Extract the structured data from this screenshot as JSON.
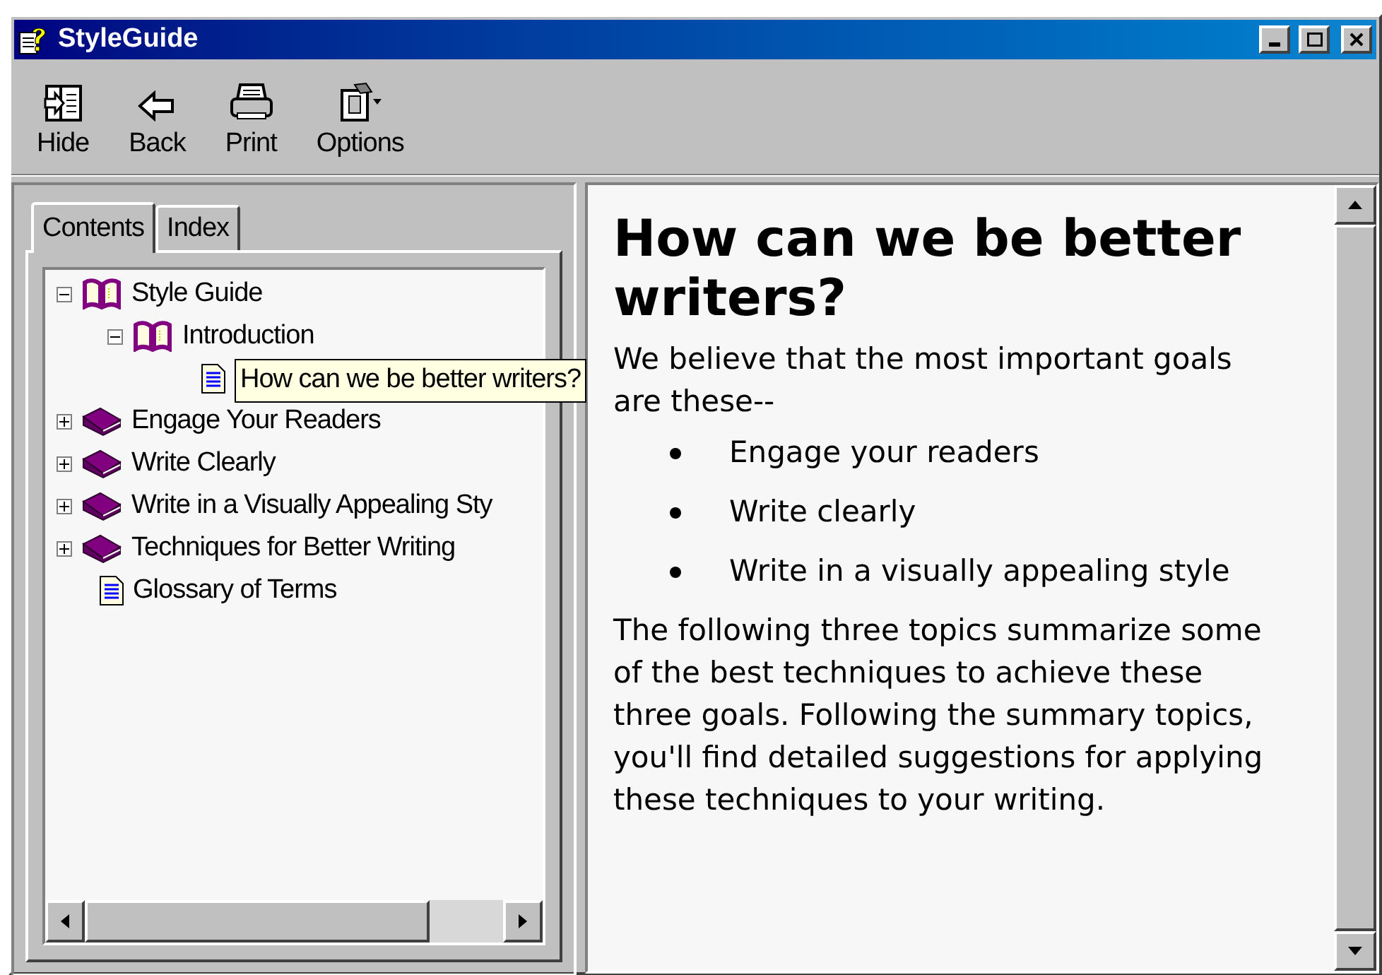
{
  "window": {
    "title": "StyleGuide"
  },
  "toolbar": [
    {
      "kind": "hide",
      "label": "Hide"
    },
    {
      "kind": "back",
      "label": "Back"
    },
    {
      "kind": "print",
      "label": "Print"
    },
    {
      "kind": "options",
      "label": "Options"
    }
  ],
  "tabs": [
    {
      "label": "Contents",
      "selected": true
    },
    {
      "label": "Index",
      "selected": false
    }
  ],
  "tree": [
    {
      "kind": "book",
      "label": "Style Guide",
      "expanded": true,
      "children": [
        {
          "kind": "book",
          "label": "Introduction",
          "expanded": true,
          "children": [
            {
              "kind": "page",
              "tooltip": "How can we be better writers?"
            }
          ]
        }
      ]
    },
    {
      "kind": "book",
      "label": "Engage Your Readers",
      "expanded": false
    },
    {
      "kind": "book",
      "label": "Write Clearly",
      "expanded": false
    },
    {
      "kind": "book",
      "label": "Write in a Visually Appealing Sty",
      "expanded": false
    },
    {
      "kind": "book",
      "label": "Techniques for Better Writing",
      "expanded": false
    },
    {
      "kind": "page",
      "label": "Glossary of Terms"
    }
  ],
  "topic": {
    "heading": "How can we be better writers?",
    "intro": "We believe that the most important goals are these--",
    "bullets": [
      "Engage your readers",
      "Write clearly",
      "Write in a visually appealing style"
    ],
    "body": "The following three topics summarize some of the best techniques to achieve these three goals. Following the summary topics, you'll find detailed suggestions for applying these techniques to your writing."
  }
}
